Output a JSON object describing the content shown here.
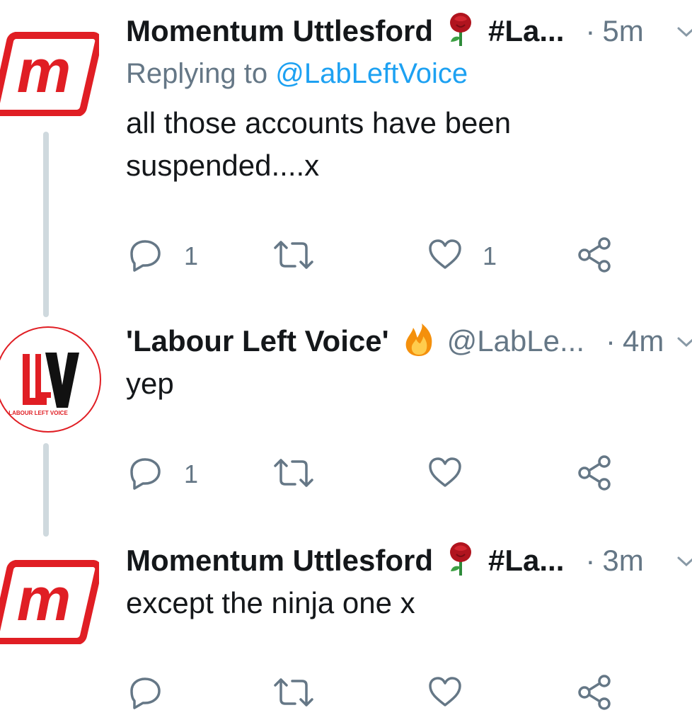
{
  "tweets": [
    {
      "display_name": "Momentum Uttlesford",
      "name_emoji": "rose",
      "hashtag": "#La...",
      "time": "5m",
      "replying_label": "Replying to",
      "replying_handle": "@LabLeftVoice",
      "text": "all those accounts have been suspended....x",
      "reply_count": "1",
      "like_count": "1"
    },
    {
      "display_name": "'Labour Left Voice'",
      "name_emoji": "fire",
      "handle": "@LabLe...",
      "time": "4m",
      "text": "yep",
      "reply_count": "1",
      "avatar_caption": "LABOUR LEFT VOICE"
    },
    {
      "display_name": "Momentum Uttlesford",
      "name_emoji": "rose",
      "hashtag": "#La...",
      "time": "3m",
      "text": "except the ninja one x"
    }
  ],
  "separator": "·",
  "colors": {
    "text": "#14171a",
    "secondary": "#657786",
    "link": "#1da1f2",
    "momentum_red": "#e01e24",
    "thread_line": "#cfd9de"
  },
  "icons": [
    "reply-icon",
    "retweet-icon",
    "like-icon",
    "share-icon",
    "caret-down-icon",
    "rose-emoji",
    "fire-emoji"
  ]
}
